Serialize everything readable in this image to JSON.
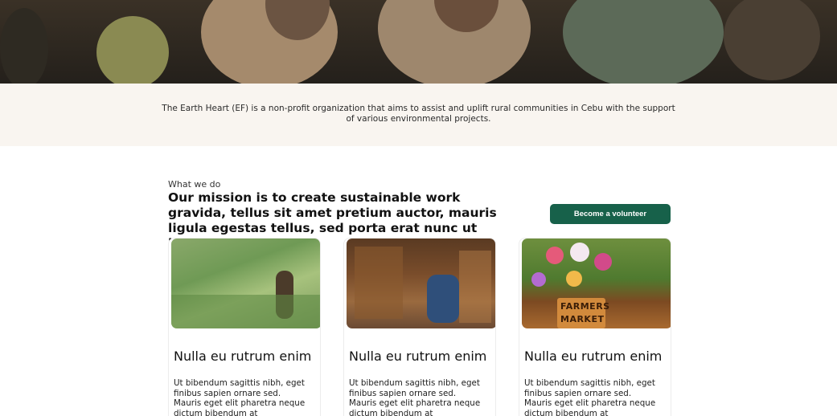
{
  "intro": {
    "text": "The Earth Heart (EF) is a non-profit organization that aims to assist and uplift rural communities in Cebu with the support of various environmental projects."
  },
  "what_we_do": {
    "eyebrow": "What we do",
    "mission": "Our mission is to create sustainable work gravida, tellus sit amet pretium auctor, mauris ligula egestas tellus, sed porta erat nunc ut ligula.",
    "button_label": "Become a volunteer",
    "button_color": "#17614a"
  },
  "cards": [
    {
      "image": "rice-terrace-farmer-photo",
      "title": "Nulla eu rutrum enim",
      "body": "Ut bibendum sagittis nibh, eget finibus sapien ornare sed. Mauris eget elit pharetra neque dictum bibendum at vestibulum sapien."
    },
    {
      "image": "market-stall-photo",
      "title": "Nulla eu rutrum enim",
      "body": "Ut bibendum sagittis nibh, eget finibus sapien ornare sed. Mauris eget elit pharetra neque dictum bibendum at vestibulum sapien."
    },
    {
      "image": "farmers-market-flowers-photo",
      "sign_text": [
        "FARMERS",
        "MARKET"
      ],
      "title": "Nulla eu rutrum enim",
      "body": "Ut bibendum sagittis nibh, eget finibus sapien ornare sed. Mauris eget elit pharetra neque dictum bibendum at vestibulum sapien."
    }
  ]
}
